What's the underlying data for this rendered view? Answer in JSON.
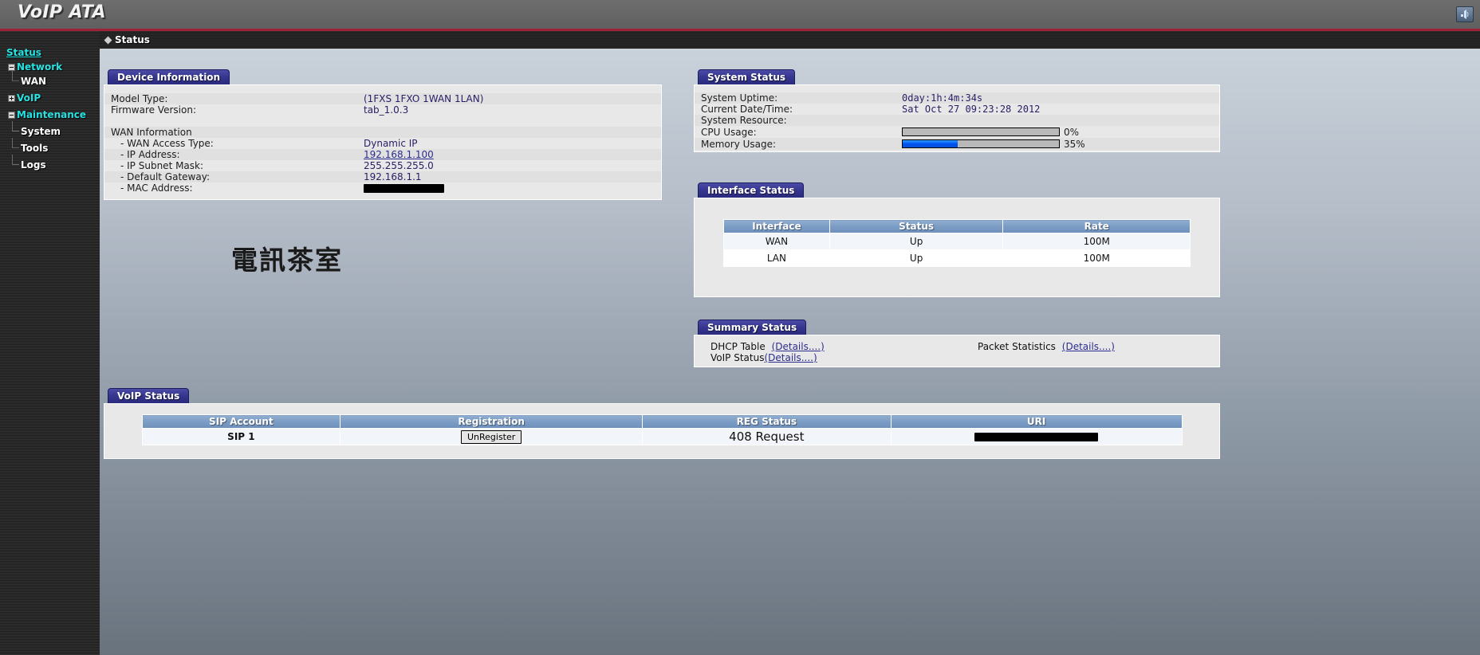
{
  "header": {
    "logo": "VoIP ATA",
    "icon": "signal-icon"
  },
  "breadcrumb": {
    "label": "Status"
  },
  "sidebar": {
    "items": [
      {
        "label": "Status",
        "level": 0,
        "style": "active",
        "toggle": "none"
      },
      {
        "label": "Network",
        "level": 1,
        "style": "cyan",
        "toggle": "minus"
      },
      {
        "label": "WAN",
        "level": 2,
        "style": "white",
        "toggle": "none"
      },
      {
        "label": "VoIP",
        "level": 1,
        "style": "cyan",
        "toggle": "plus"
      },
      {
        "label": "Maintenance",
        "level": 1,
        "style": "cyan",
        "toggle": "minus"
      },
      {
        "label": "System",
        "level": 2,
        "style": "white",
        "toggle": "none"
      },
      {
        "label": "Tools",
        "level": 2,
        "style": "white",
        "toggle": "none"
      },
      {
        "label": "Logs",
        "level": 2,
        "style": "white",
        "toggle": "none"
      }
    ]
  },
  "device_information": {
    "title": "Device Information",
    "model_type_label": "Model Type:",
    "model_type_value": "(1FXS 1FXO 1WAN 1LAN)",
    "firmware_label": "Firmware Version:",
    "firmware_value": "tab_1.0.3",
    "wan_heading": "WAN Information",
    "wan_access_type_label": "- WAN Access Type:",
    "wan_access_type_value": "Dynamic IP",
    "ip_address_label": "- IP Address:",
    "ip_address_value": "192.168.1.100",
    "subnet_label": "- IP Subnet Mask:",
    "subnet_value": "255.255.255.0",
    "gateway_label": "- Default Gateway:",
    "gateway_value": "192.168.1.1",
    "mac_label": "- MAC Address:",
    "mac_value_redacted": true
  },
  "watermark": {
    "text": "電訊茶室"
  },
  "system_status": {
    "title": "System Status",
    "uptime_label": "System Uptime:",
    "uptime_value": "0day:1h:4m:34s",
    "datetime_label": "Current Date/Time:",
    "datetime_value": "Sat Oct 27 09:23:28 2012",
    "resource_label": "System Resource:",
    "cpu_label": "CPU Usage:",
    "cpu_percent": 0,
    "cpu_percent_text": "0%",
    "memory_label": "Memory Usage:",
    "memory_percent": 35,
    "memory_percent_text": "35%",
    "bar_fill_color": "#0052f0"
  },
  "interface_status": {
    "title": "Interface Status",
    "columns": [
      "Interface",
      "Status",
      "Rate"
    ],
    "rows": [
      [
        "WAN",
        "Up",
        "100M"
      ],
      [
        "LAN",
        "Up",
        "100M"
      ]
    ]
  },
  "summary_status": {
    "title": "Summary Status",
    "dhcp_table_label": "DHCP Table",
    "dhcp_table_link": "(Details....)",
    "voip_status_label": "VoIP Status",
    "voip_status_link": "(Details....)",
    "packet_statistics_label": "Packet Statistics",
    "packet_statistics_link": "(Details....)"
  },
  "voip_status": {
    "title": "VoIP Status",
    "columns": [
      "SIP Account",
      "Registration",
      "REG Status",
      "URI"
    ],
    "row": {
      "sip_account": "SIP 1",
      "registration_button": "UnRegister",
      "reg_status": "408 Request",
      "uri_redacted": true
    }
  }
}
